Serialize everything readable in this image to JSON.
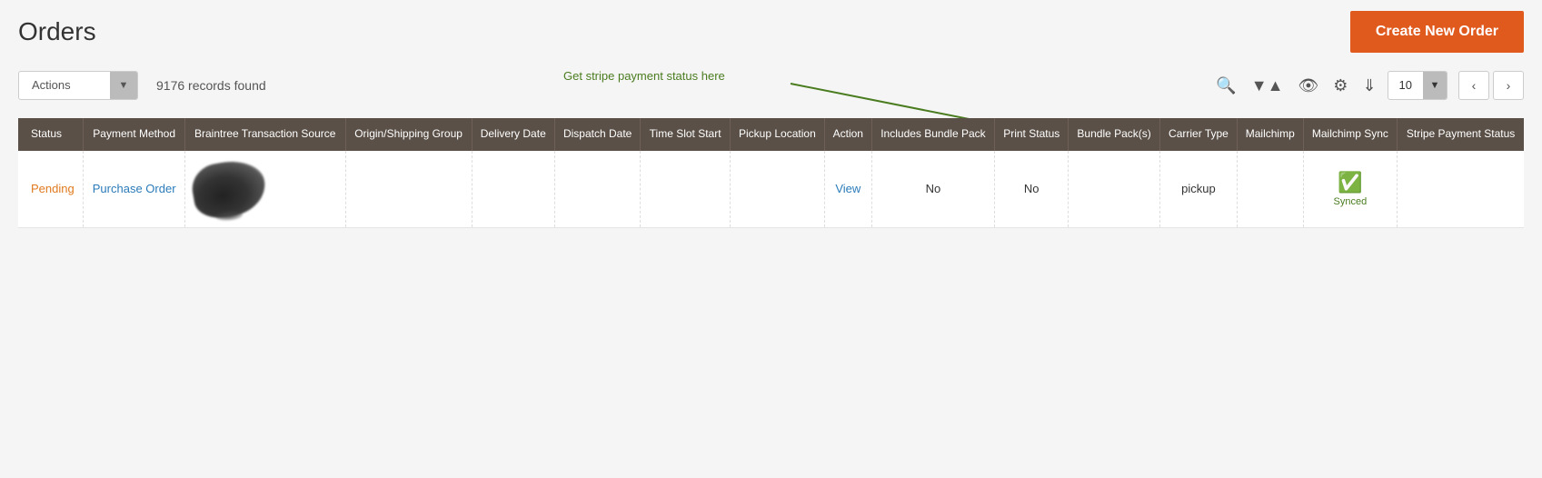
{
  "header": {
    "title": "Orders",
    "create_button_label": "Create New Order"
  },
  "toolbar": {
    "actions_label": "Actions",
    "records_found": "9176 records found",
    "per_page": "10",
    "annotation_text": "Get stripe payment status here"
  },
  "table": {
    "columns": [
      {
        "id": "status",
        "label": "Status"
      },
      {
        "id": "payment_method",
        "label": "Payment Method"
      },
      {
        "id": "braintree",
        "label": "Braintree Transaction Source"
      },
      {
        "id": "origin",
        "label": "Origin/Shipping Group"
      },
      {
        "id": "delivery_date",
        "label": "Delivery Date"
      },
      {
        "id": "dispatch_date",
        "label": "Dispatch Date"
      },
      {
        "id": "time_slot",
        "label": "Time Slot Start"
      },
      {
        "id": "pickup_location",
        "label": "Pickup Location"
      },
      {
        "id": "action",
        "label": "Action"
      },
      {
        "id": "includes_bundle",
        "label": "Includes Bundle Pack"
      },
      {
        "id": "print_status",
        "label": "Print Status"
      },
      {
        "id": "bundle_packs",
        "label": "Bundle Pack(s)"
      },
      {
        "id": "carrier_type",
        "label": "Carrier Type"
      },
      {
        "id": "mailchimp",
        "label": "Mailchimp"
      },
      {
        "id": "mailchimp_sync",
        "label": "Mailchimp Sync"
      },
      {
        "id": "stripe_payment",
        "label": "Stripe Payment Status"
      }
    ],
    "rows": [
      {
        "status": "Pending",
        "payment_method": "Purchase Order",
        "braintree": "",
        "origin": "",
        "delivery_date": "",
        "dispatch_date": "",
        "time_slot": "",
        "pickup_location": "",
        "action": "View",
        "includes_bundle": "No",
        "print_status": "No",
        "bundle_packs": "",
        "carrier_type": "pickup",
        "mailchimp": "",
        "mailchimp_sync": "Synced",
        "stripe_payment": ""
      }
    ]
  }
}
